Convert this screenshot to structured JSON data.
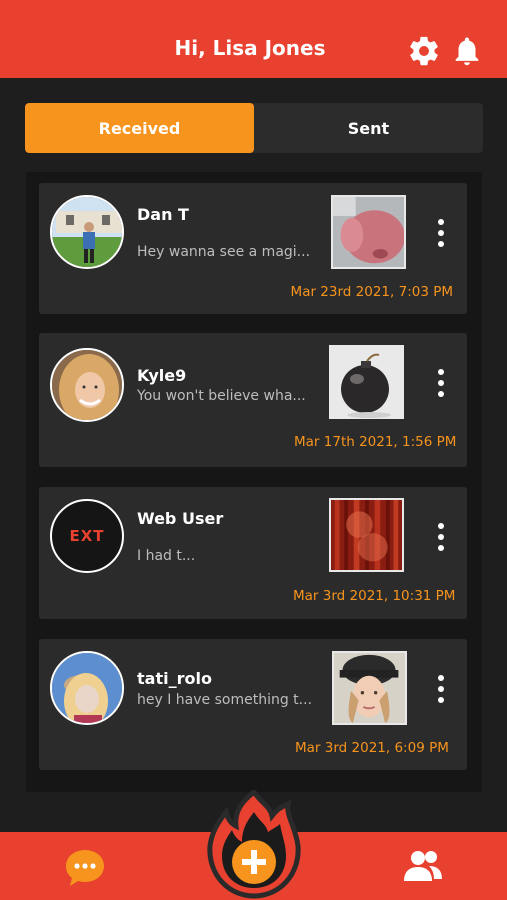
{
  "header": {
    "title": "Hi, Lisa Jones",
    "icons": [
      "gear-icon",
      "bell-icon"
    ]
  },
  "tabs": [
    {
      "label": "Received",
      "active": true
    },
    {
      "label": "Sent",
      "active": false
    }
  ],
  "messages": [
    {
      "name": "Dan T",
      "preview": "Hey wanna see a magi...",
      "date": "Mar 23rd 2021, 7:03 PM"
    },
    {
      "name": "Kyle9",
      "preview": "You won't believe wha...",
      "date": "Mar 17th 2021, 1:56 PM"
    },
    {
      "name": "Web User",
      "preview": "I had t...",
      "date": "Mar 3rd 2021, 10:31 PM",
      "avatar_text": "EXT"
    },
    {
      "name": "tati_rolo",
      "preview": "hey I have something t...",
      "date": "Mar 3rd 2021, 6:09 PM"
    }
  ],
  "footer": {
    "icons": [
      "chat-bubble-icon",
      "add-flame-button-icon",
      "users-icon"
    ]
  },
  "colors": {
    "brand": "#e8412f",
    "accent": "#f7941d",
    "card": "#2b2b2b",
    "background": "#1e1e1e"
  }
}
